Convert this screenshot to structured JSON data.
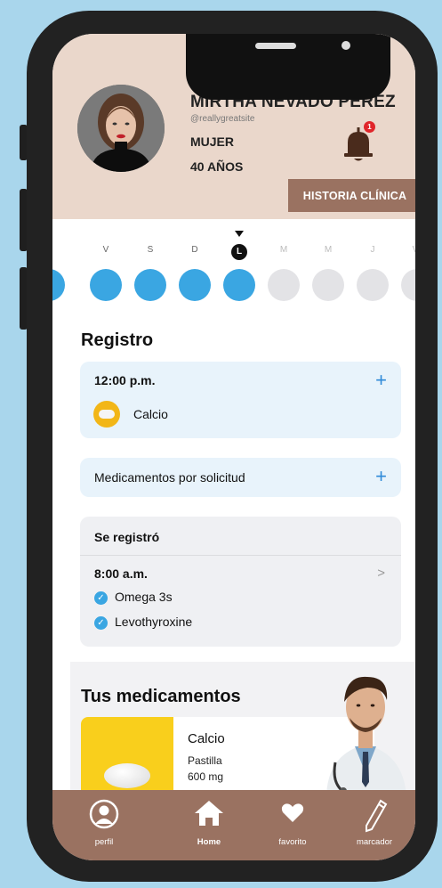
{
  "profile": {
    "name": "MIRTHA NEVADO PEREZ",
    "handle": "@reallygreatsite",
    "sex": "MUJER",
    "age": "40 AÑOS",
    "notification_count": "1",
    "history_button": "HISTORIA CLÍNICA"
  },
  "week": {
    "days": [
      "V",
      "S",
      "D",
      "L",
      "M",
      "M",
      "J",
      "V"
    ],
    "today": "L"
  },
  "registro": {
    "title": "Registro",
    "scheduled": {
      "time": "12:00 p.m.",
      "medication": "Calcio"
    },
    "on_demand_label": "Medicamentos por solicitud",
    "logged": {
      "header": "Se registró",
      "time": "8:00 a.m.",
      "items": [
        "Omega 3s",
        "Levothyroxine"
      ]
    }
  },
  "medications": {
    "title": "Tus medicamentos",
    "items": [
      {
        "name": "Calcio",
        "type": "Pastilla",
        "dose": "600 mg"
      }
    ]
  },
  "nav": {
    "items": [
      {
        "label": "perfil",
        "icon": "user-icon"
      },
      {
        "label": "Home",
        "icon": "home-icon"
      },
      {
        "label": "favorito",
        "icon": "heart-icon"
      },
      {
        "label": "marcador",
        "icon": "pencil-icon"
      }
    ]
  },
  "colors": {
    "header_bg": "#ead7cb",
    "brand_brown": "#9a7261",
    "accent_blue": "#3aa6e2",
    "page_bg": "#a9d6ec"
  }
}
